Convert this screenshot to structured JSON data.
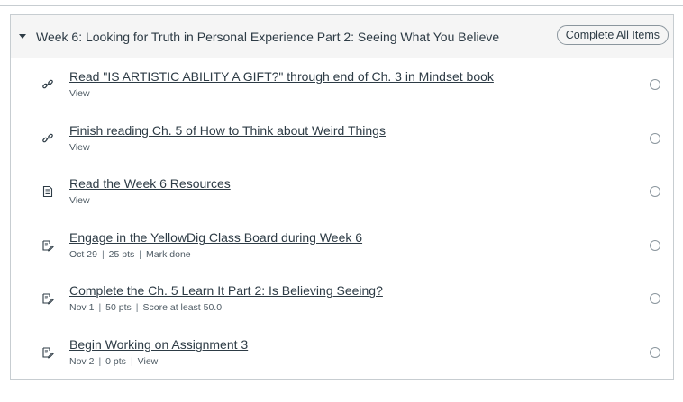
{
  "module": {
    "title": "Week 6: Looking for Truth in Personal Experience Part 2: Seeing What You Believe",
    "complete_all_label": "Complete All Items"
  },
  "items": [
    {
      "icon": "link-icon",
      "title": "Read \"IS ARTISTIC ABILITY A GIFT?\" through end of Ch. 3 in Mindset book",
      "meta": [
        "View"
      ]
    },
    {
      "icon": "link-icon",
      "title": "Finish reading Ch. 5 of How to Think about Weird Things",
      "meta": [
        "View"
      ]
    },
    {
      "icon": "page-icon",
      "title": "Read the Week 6 Resources",
      "meta": [
        "View"
      ]
    },
    {
      "icon": "assignment-icon",
      "title": "Engage in the YellowDig Class Board during Week 6",
      "meta": [
        "Oct 29",
        "25 pts",
        "Mark done"
      ]
    },
    {
      "icon": "assignment-icon",
      "title": "Complete the Ch. 5 Learn It Part 2: Is Believing Seeing?",
      "meta": [
        "Nov 1",
        "50 pts",
        "Score at least 50.0"
      ]
    },
    {
      "icon": "assignment-icon",
      "title": "Begin Working on Assignment 3",
      "meta": [
        "Nov 2",
        "0 pts",
        "View"
      ]
    }
  ]
}
